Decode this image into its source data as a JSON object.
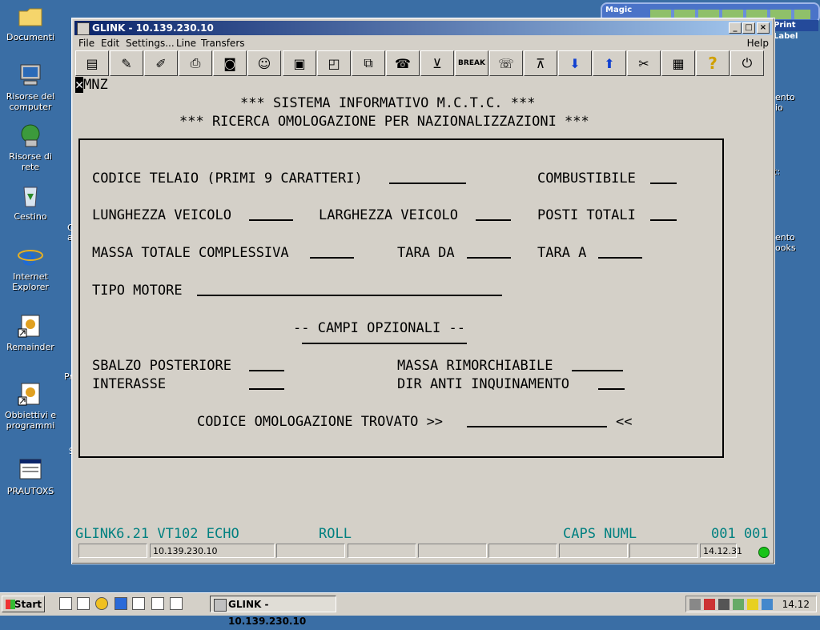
{
  "desktop": {
    "icons": [
      {
        "label": "Documenti"
      },
      {
        "label": "Risorse del computer"
      },
      {
        "label": "Risorse di rete"
      },
      {
        "label": "Cestino"
      },
      {
        "label": "Internet Explorer"
      },
      {
        "label": "Remainder"
      },
      {
        "label": "Obbiettivi e programmi"
      },
      {
        "label": "PRAUTOXS"
      }
    ],
    "partial_right": [
      "ento",
      "io",
      "t:",
      "ento",
      "ooks"
    ],
    "partial_left": [
      "C",
      "a",
      "Pr",
      "S"
    ]
  },
  "magic_bar": {
    "label": "Magic"
  },
  "print_label": "Print Label",
  "window": {
    "title": "GLINK - 10.139.230.10",
    "controls": {
      "minimize": "_",
      "maximize": "□",
      "close": "×"
    },
    "menu": [
      "File",
      "Edit",
      "Settings...",
      "Line",
      "Transfers"
    ],
    "help": "Help",
    "toolbar_icons": [
      "drawer-icon",
      "pencil-icon",
      "brush-icon",
      "printer-icon",
      "camera-icon",
      "user-icon",
      "window-icon",
      "window-resize-icon",
      "copy-icon",
      "phone-icon",
      "download-icon",
      "break-icon",
      "phone-hangup-icon",
      "upload-icon",
      "arrow-down-icon",
      "arrow-up-icon",
      "tools-icon",
      "keyboard-icon",
      "help-icon",
      "exit-icon"
    ],
    "toolbar_glyphs": [
      "▤",
      "✎",
      "✐",
      "⎙",
      "◙",
      "☺",
      "▣",
      "◰",
      "⧉",
      "☎",
      "⊻",
      "BREAK",
      "☏",
      "⊼",
      "⬇",
      "⬆",
      "✂",
      "▦",
      "?",
      "⏻"
    ]
  },
  "terminal": {
    "cursor_char": "✕",
    "id": "MNZ",
    "heading1": "*** SISTEMA INFORMATIVO M.C.T.C. ***",
    "heading2": "*** RICERCA OMOLOGAZIONE PER NAZIONALIZZAZIONI ***",
    "codice_telaio": "CODICE TELAIO (PRIMI 9 CARATTERI)",
    "combustibile": "COMBUSTIBILE",
    "lunghezza": "LUNGHEZZA VEICOLO",
    "larghezza": "LARGHEZZA VEICOLO",
    "posti": "POSTI TOTALI",
    "massa": "MASSA TOTALE COMPLESSIVA",
    "tara_da": "TARA DA",
    "tara_a": "TARA A",
    "tipo_motore": "TIPO MOTORE",
    "campi": "-- CAMPI OPZIONALI --",
    "sbalzo": "SBALZO POSTERIORE",
    "massa_rim": "MASSA RIMORCHIABILE",
    "interasse": "INTERASSE",
    "dir_anti": "DIR ANTI INQUINAMENTO",
    "codice_omol": "CODICE OMOLOGAZIONE TROVATO >>",
    "codice_omol_end": "<<",
    "status_left": "GLINK6.21 VT102 ECHO",
    "status_roll": "ROLL",
    "status_caps": "CAPS NUML",
    "status_pos": "001 001"
  },
  "statusbar": {
    "host": "10.139.230.10",
    "time": "14.12.31",
    "led_color": "#18c418"
  },
  "taskbar": {
    "start": "Start",
    "task": "GLINK - 10.139.230.10",
    "clock": "14.12"
  }
}
